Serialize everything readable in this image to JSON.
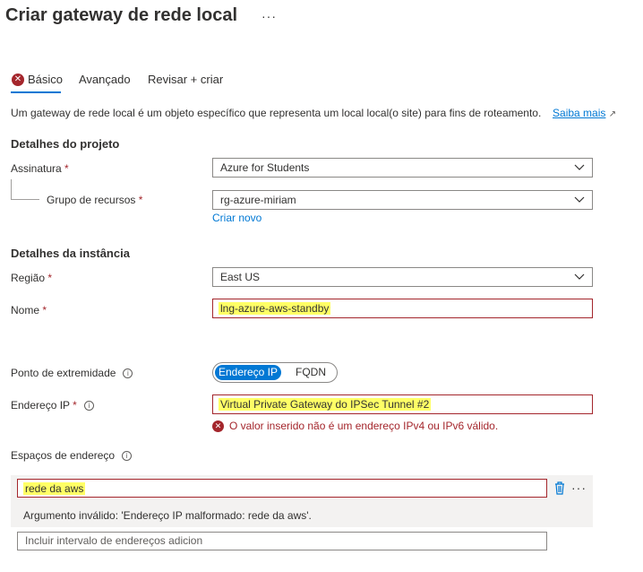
{
  "page": {
    "title": "Criar gateway de rede local",
    "more_label": "···"
  },
  "tabs": [
    {
      "label": "Básico",
      "active": true,
      "has_error": true
    },
    {
      "label": "Avançado"
    },
    {
      "label": "Revisar + criar"
    }
  ],
  "description": {
    "text": "Um gateway de rede local é um objeto específico que representa um local local(o site) para fins de roteamento.",
    "link": "Saiba mais"
  },
  "project": {
    "heading": "Detalhes do projeto",
    "subscription_label": "Assinatura",
    "subscription_value": "Azure for Students",
    "resource_group_label": "Grupo de recursos",
    "resource_group_value": "rg-azure-miriam",
    "create_new": "Criar novo"
  },
  "instance": {
    "heading": "Detalhes da instância",
    "region_label": "Região",
    "region_value": "East US",
    "name_label": "Nome",
    "name_value": "lng-azure-aws-standby"
  },
  "endpoint": {
    "label": "Ponto de extremidade",
    "options": [
      "Endereço IP",
      "FQDN"
    ],
    "selected": "Endereço IP"
  },
  "ip": {
    "label": "Endereço IP",
    "value": "Virtual Private Gateway do IPSec Tunnel #2",
    "error": "O valor inserido não é um endereço IPv4 ou IPv6 válido."
  },
  "address_spaces": {
    "label": "Espaços de endereço",
    "entry_value": "rede da aws",
    "entry_error": "Argumento inválido: 'Endereço IP malformado: rede da aws'.",
    "add_placeholder": "Incluir intervalo de endereços adicion",
    "more_label": "···"
  },
  "colors": {
    "accent": "#0078d4",
    "error": "#a4262c",
    "highlight": "#ffff66"
  }
}
